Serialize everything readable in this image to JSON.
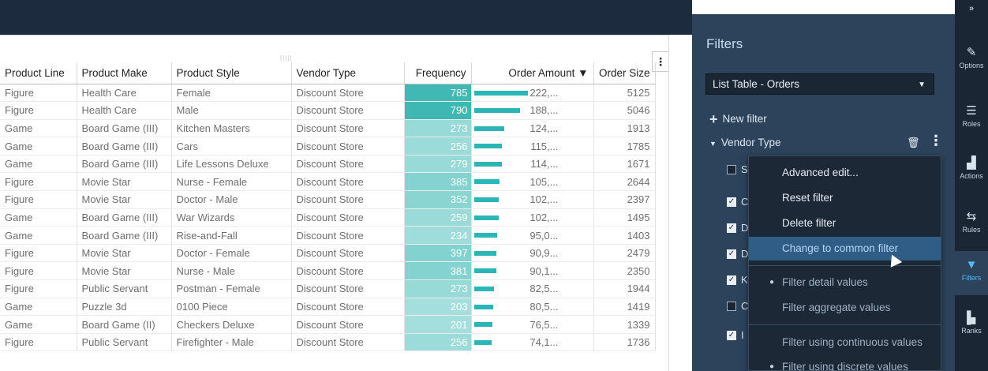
{
  "table": {
    "columns": [
      "Product Line",
      "Product Make",
      "Product Style",
      "Vendor Type",
      "Frequency",
      "Order Amount ▼",
      "Order Size"
    ],
    "rows": [
      {
        "line": "Figure",
        "make": "Health Care",
        "style": "Female",
        "vendor": "Discount Store",
        "frequency": "785",
        "amount": "222,...",
        "amount_level": 1.0,
        "size": "5125"
      },
      {
        "line": "Figure",
        "make": "Health Care",
        "style": "Male",
        "vendor": "Discount Store",
        "frequency": "790",
        "amount": "188,...",
        "amount_level": 0.85,
        "size": "5046"
      },
      {
        "line": "Game",
        "make": "Board Game (III)",
        "style": "Kitchen Masters",
        "vendor": "Discount Store",
        "frequency": "273",
        "amount": "124,...",
        "amount_level": 0.56,
        "size": "1913"
      },
      {
        "line": "Game",
        "make": "Board Game (III)",
        "style": "Cars",
        "vendor": "Discount Store",
        "frequency": "256",
        "amount": "115,...",
        "amount_level": 0.52,
        "size": "1785"
      },
      {
        "line": "Game",
        "make": "Board Game (III)",
        "style": "Life Lessons Deluxe",
        "vendor": "Discount Store",
        "frequency": "279",
        "amount": "114,...",
        "amount_level": 0.51,
        "size": "1671"
      },
      {
        "line": "Figure",
        "make": "Movie Star",
        "style": "Nurse - Female",
        "vendor": "Discount Store",
        "frequency": "385",
        "amount": "105,...",
        "amount_level": 0.47,
        "size": "2644"
      },
      {
        "line": "Figure",
        "make": "Movie Star",
        "style": "Doctor - Male",
        "vendor": "Discount Store",
        "frequency": "352",
        "amount": "102,...",
        "amount_level": 0.46,
        "size": "2397"
      },
      {
        "line": "Game",
        "make": "Board Game (III)",
        "style": "War Wizards",
        "vendor": "Discount Store",
        "frequency": "259",
        "amount": "102,...",
        "amount_level": 0.46,
        "size": "1495"
      },
      {
        "line": "Game",
        "make": "Board Game (III)",
        "style": "Rise-and-Fall",
        "vendor": "Discount Store",
        "frequency": "234",
        "amount": "95,0...",
        "amount_level": 0.43,
        "size": "1403"
      },
      {
        "line": "Figure",
        "make": "Movie Star",
        "style": "Doctor - Female",
        "vendor": "Discount Store",
        "frequency": "397",
        "amount": "90,9...",
        "amount_level": 0.41,
        "size": "2479"
      },
      {
        "line": "Figure",
        "make": "Movie Star",
        "style": "Nurse - Male",
        "vendor": "Discount Store",
        "frequency": "381",
        "amount": "90,1...",
        "amount_level": 0.41,
        "size": "2350"
      },
      {
        "line": "Figure",
        "make": "Public Servant",
        "style": "Postman - Female",
        "vendor": "Discount Store",
        "frequency": "273",
        "amount": "82,5...",
        "amount_level": 0.37,
        "size": "1944"
      },
      {
        "line": "Game",
        "make": "Puzzle 3d",
        "style": "0100 Piece",
        "vendor": "Discount Store",
        "frequency": "203",
        "amount": "80,5...",
        "amount_level": 0.36,
        "size": "1419"
      },
      {
        "line": "Game",
        "make": "Board Game (II)",
        "style": "Checkers Deluxe",
        "vendor": "Discount Store",
        "frequency": "201",
        "amount": "76,5...",
        "amount_level": 0.34,
        "size": "1339"
      },
      {
        "line": "Figure",
        "make": "Public Servant",
        "style": "Firefighter - Male",
        "vendor": "Discount Store",
        "frequency": "256",
        "amount": "74,1...",
        "amount_level": 0.33,
        "size": "1736"
      }
    ]
  },
  "filters": {
    "title": "Filters",
    "object_select": "List Table - Orders",
    "new_filter_label": "New filter",
    "filter_name": "Vendor Type",
    "checkbox_letters": [
      "S",
      "C",
      "D",
      "D",
      "K",
      "C",
      "I"
    ]
  },
  "context_menu": {
    "items": [
      "Advanced edit...",
      "Reset filter",
      "Delete filter",
      "Change to common filter",
      "Filter detail values",
      "Filter aggregate values",
      "Filter using continuous values",
      "Filter using discrete values"
    ]
  },
  "rail": {
    "expand_label": "»",
    "tabs": [
      {
        "label": "Options",
        "icon": "brush-icon"
      },
      {
        "label": "Roles",
        "icon": "roles-icon"
      },
      {
        "label": "Actions",
        "icon": "actions-icon"
      },
      {
        "label": "Rules",
        "icon": "rules-icon"
      },
      {
        "label": "Filters",
        "icon": "filter-icon"
      },
      {
        "label": "Ranks",
        "icon": "ranks-icon"
      }
    ]
  },
  "colors": {
    "frequency_high": "#3fb8b4",
    "frequency_low": "#a4dfdd",
    "amount_bar": "#2bb5b7",
    "menu_highlight": "#2f5d86",
    "active_tab": "#55b9f3"
  }
}
